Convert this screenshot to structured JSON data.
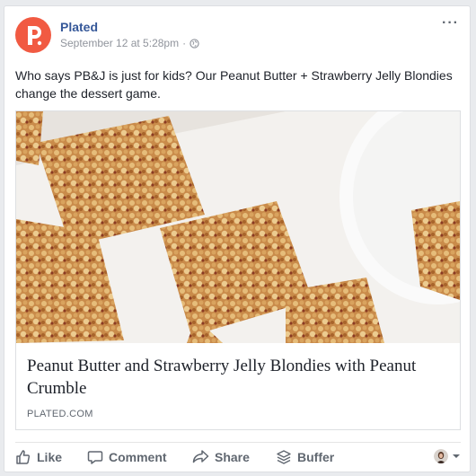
{
  "post": {
    "page_name": "Plated",
    "timestamp": "September 12 at 5:28pm",
    "separator": "·",
    "more": "···",
    "text": "Who says PB&J is just for kids? Our Peanut Butter + Strawberry Jelly Blondies change the dessert game.",
    "logo_letter": "P"
  },
  "link": {
    "title": "Peanut Butter and Strawberry Jelly Blondies with Peanut Crumble",
    "domain": "PLATED.COM"
  },
  "actions": {
    "like": "Like",
    "comment": "Comment",
    "share": "Share",
    "buffer": "Buffer"
  },
  "colors": {
    "brand": "#f15a42",
    "link_blue": "#365899",
    "text": "#1d2129",
    "muted": "#90949c"
  }
}
